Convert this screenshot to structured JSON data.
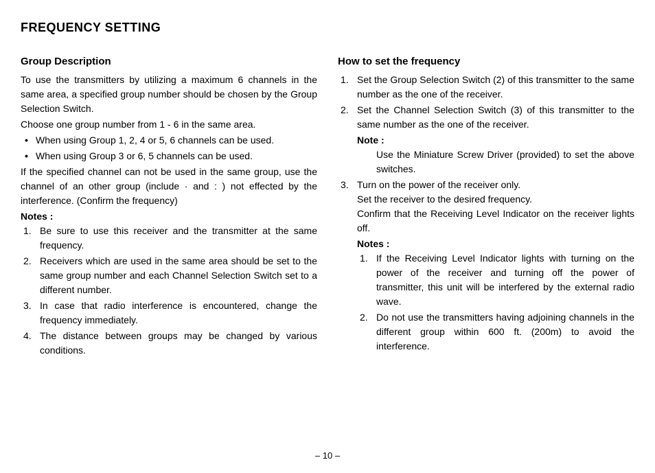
{
  "title": "FREQUENCY SETTING",
  "left": {
    "heading": "Group Description",
    "p1": "To use the transmitters by utilizing a maximum 6 channels in the same area, a specified group number should be chosen by the Group Selection Switch.",
    "p2": "Choose one group number from 1 - 6 in the same area.",
    "bullets": [
      "When using Group 1, 2, 4 or 5, 6 channels can be used.",
      "When using Group 3 or 6, 5 channels can be used."
    ],
    "p3": "If the specified channel can not be used in the same group, use the channel of an other group (include · and : ) not effected by the interference. (Confirm the frequency)",
    "notesLabel": "Notes :",
    "notes": [
      "Be sure to use this receiver and the transmitter at the same frequency.",
      "Receivers which are used in the same area should be set to the same group number and each Channel Selection Switch set to a different number.",
      "In case that radio interference is encountered, change the frequency immediately.",
      "The distance between groups may be changed by various conditions."
    ]
  },
  "right": {
    "heading": "How to set the frequency",
    "steps": [
      "Set the Group Selection Switch (2) of this transmitter to the same number as the one of the receiver.",
      "Set the Channel Selection Switch (3) of this transmitter to the same number as the one of the receiver."
    ],
    "noteLabel": "Note :",
    "noteText": "Use the Miniature Screw Driver (provided) to set the above switches.",
    "step3": "Turn on the power of the receiver only.",
    "step3b": "Set the receiver to the desired frequency.",
    "step3c": "Confirm that the Receiving Level Indicator on the receiver lights off.",
    "notesLabel": "Notes :",
    "notes": [
      "If the Receiving Level Indicator lights with turning on the power of the receiver and turning off the power of transmitter, this unit will be interfered by the external radio wave.",
      "Do not use the transmitters having adjoining channels in the different group within 600 ft. (200m) to avoid the interference."
    ]
  },
  "pageNumber": "– 10 –"
}
